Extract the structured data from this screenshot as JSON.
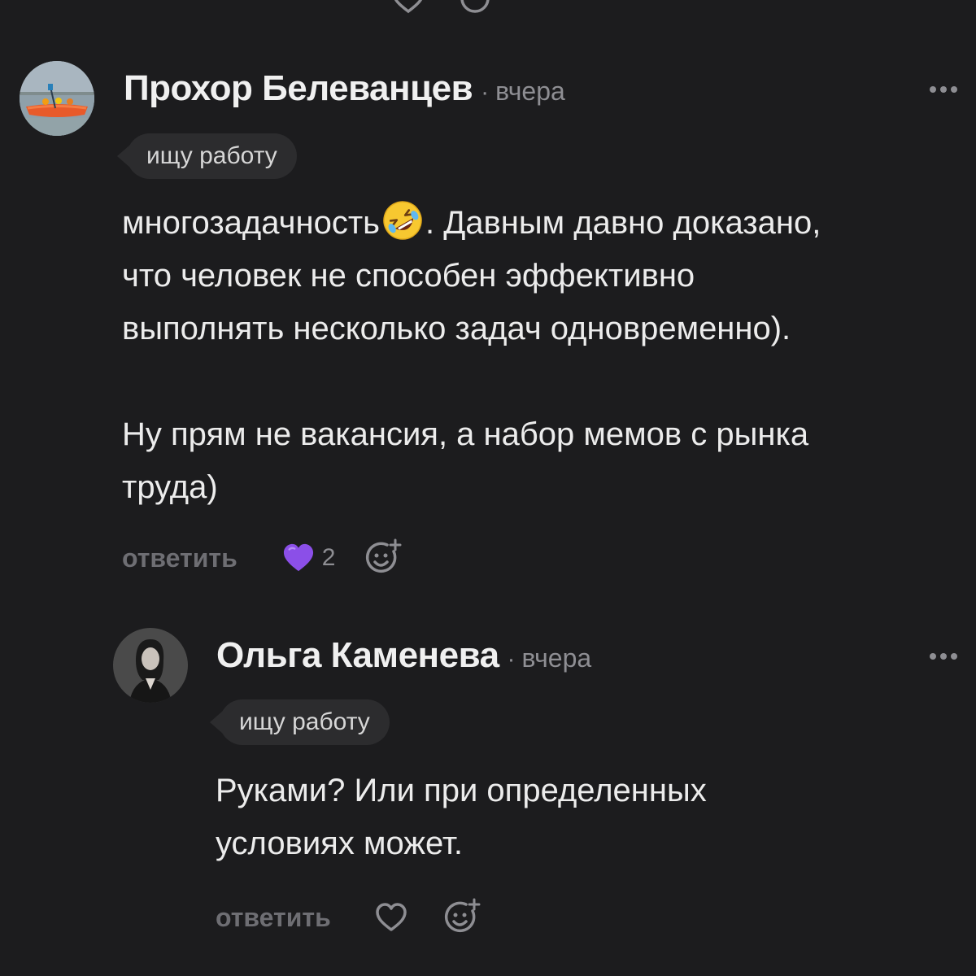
{
  "comments": [
    {
      "author": "Прохор Белеванцев",
      "separator": "·",
      "time": "вчера",
      "badge": "ищу работу",
      "avatar_icon": "boat-photo",
      "text_lines_p1_before_emoji": "многозадачность",
      "emoji_icon": "rolling-on-floor-laughing-emoji",
      "text_lines_p1_after_emoji": ". Давным давно доказано,",
      "text_line2": "что человек не способен эффективно",
      "text_line3": "выполнять несколько задач одновременно).",
      "text_para2_line1": "Ну прям не вакансия, а набор мемов с рынка",
      "text_para2_line2": "труда)",
      "reply_label": "ответить",
      "like_icon": "purple-heart-icon",
      "like_count": "2",
      "like_color": "#8b4fe8",
      "react_icon": "add-reaction-icon"
    },
    {
      "author": "Ольга Каменева",
      "separator": "·",
      "time": "вчера",
      "badge": "ищу работу",
      "avatar_icon": "woman-portrait-photo",
      "text_line1": "Руками? Или при определенных",
      "text_line2": "условиях может.",
      "reply_label": "ответить",
      "like_icon": "heart-outline-icon",
      "react_icon": "add-reaction-icon"
    }
  ],
  "colors": {
    "background": "#1c1c1e",
    "badge_bg": "#2c2c2e",
    "muted": "#8e8e93",
    "reply": "#6e6e73"
  }
}
